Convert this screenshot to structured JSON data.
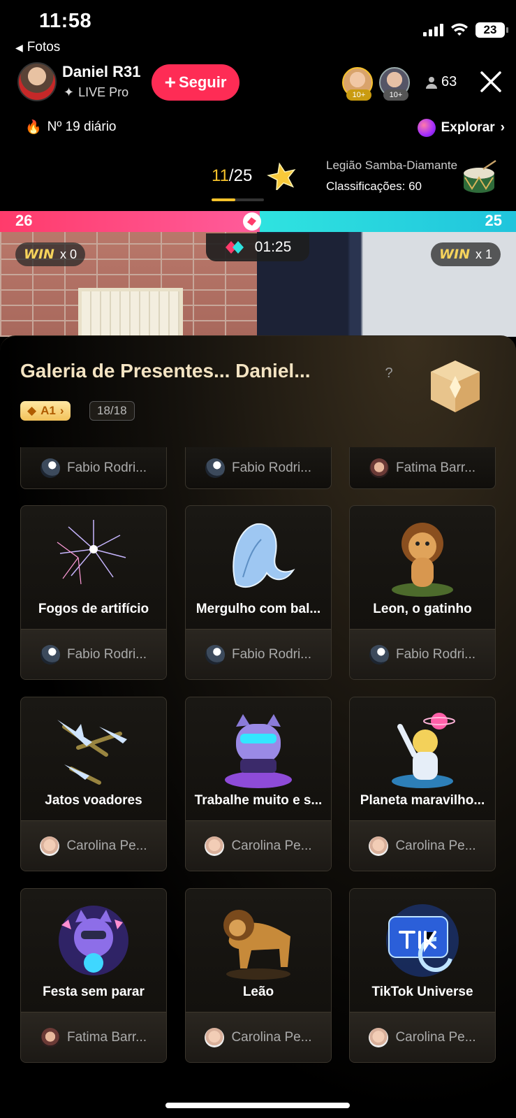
{
  "status_bar": {
    "time": "11:58",
    "battery": "23"
  },
  "back_label": "Fotos",
  "host": {
    "name": "Daniel R31",
    "badge": "LIVE Pro",
    "follow_label": "Seguir"
  },
  "viewers": {
    "badge1": "10+",
    "badge2": "10+",
    "count": "63"
  },
  "rank_label": "Nº 19 diário",
  "explore_label": "Explorar",
  "progress": {
    "current": "11",
    "total": "/25"
  },
  "legion": {
    "name": "Legião Samba-Diamante",
    "rankings": "Classificações: 60"
  },
  "battle": {
    "score_left": "26",
    "score_right": "25",
    "timer": "01:25",
    "win_left": "x 0",
    "win_right": "x 1",
    "win_word": "WIN"
  },
  "panel": {
    "title": "Galeria de Presentes... Daniel...",
    "help": "?",
    "level": "A1",
    "collected": "18/18"
  },
  "top_partial": [
    {
      "sender": "Fabio Rodri..."
    },
    {
      "sender": "Fabio Rodri..."
    },
    {
      "sender": "Fatima Barr..."
    }
  ],
  "gifts": [
    {
      "name": "Fogos de artifício",
      "sender": "Fabio Rodri..."
    },
    {
      "name": "Mergulho com bal...",
      "sender": "Fabio Rodri..."
    },
    {
      "name": "Leon, o gatinho",
      "sender": "Fabio Rodri..."
    },
    {
      "name": "Jatos voadores",
      "sender": "Carolina Pe..."
    },
    {
      "name": "Trabalhe muito e s...",
      "sender": "Carolina Pe..."
    },
    {
      "name": "Planeta maravilho...",
      "sender": "Carolina Pe..."
    },
    {
      "name": "Festa sem parar",
      "sender": "Fatima Barr..."
    },
    {
      "name": "Leão",
      "sender": "Carolina Pe..."
    },
    {
      "name": "TikTok Universe",
      "sender": "Carolina Pe..."
    }
  ],
  "colors": {
    "accent": "#fe2c55",
    "battle_red": "#ff3b6b",
    "battle_blue": "#2fe3e0",
    "gold": "#f5c22b"
  }
}
